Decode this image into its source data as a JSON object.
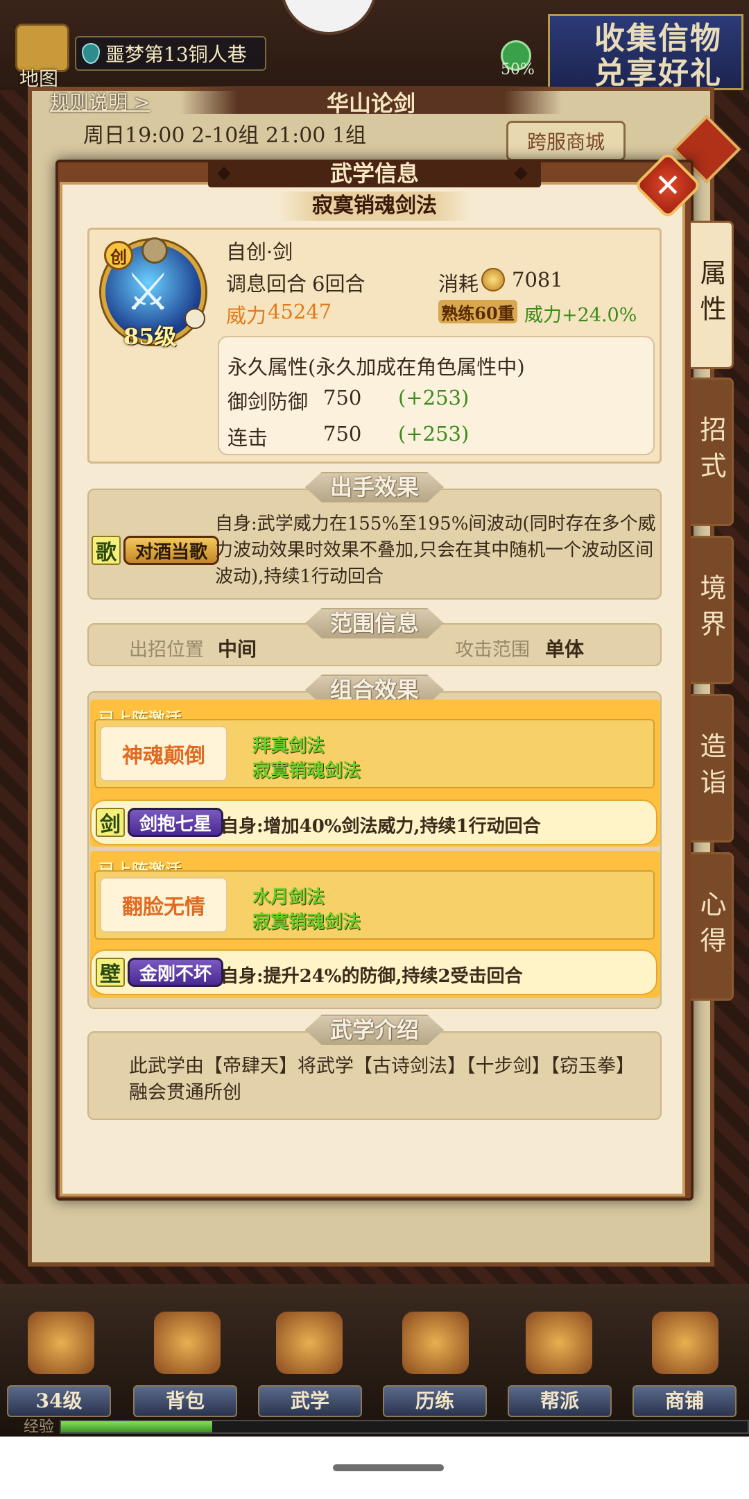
{
  "hud": {
    "map_label": "地图",
    "location": "噩梦第13铜人巷",
    "progress_pct": "50%",
    "promo_line1": "收集信物",
    "promo_line2": "兑享好礼"
  },
  "under_panel": {
    "rules_link": "规则说明 >",
    "title": "华山论剑",
    "schedule": "周日19:00 2-10组 21:00 1组",
    "shop_button": "跨服商城"
  },
  "modal": {
    "title": "武学信息",
    "skill_name": "寂寞销魂剑法",
    "close": "✕"
  },
  "side_tabs": [
    "属性",
    "招式",
    "境界",
    "造诣",
    "心得"
  ],
  "skill": {
    "type": "自创·剑",
    "chuang_badge": "创",
    "level": "85级",
    "cooldown_label": "调息回合",
    "cooldown_value": "6回合",
    "cost_label": "消耗",
    "cost_value": "7081",
    "power_label": "威力",
    "power_value": "45247",
    "mastery_badge": "熟练60重",
    "mastery_bonus": "威力+24.0%",
    "permanent_title": "永久属性(永久加成在角色属性中)",
    "permanent_attrs": [
      {
        "name": "御剑防御",
        "value": "750",
        "bonus": "(+253)"
      },
      {
        "name": "连击",
        "value": "750",
        "bonus": "(+253)"
      }
    ]
  },
  "sections": {
    "effect": "出手效果",
    "range": "范围信息",
    "combo": "组合效果",
    "intro": "武学介绍"
  },
  "effect": {
    "letter": "歌",
    "tag": "对酒当歌",
    "description": "自身:武学威力在155%至195%间波动(同时存在多个威力波动效果时效果不叠加,只会在其中随机一个波动区间波动),持续1行动回合"
  },
  "range": {
    "position_label": "出招位置",
    "position_value": "中间",
    "scope_label": "攻击范围",
    "scope_value": "单体"
  },
  "combos": [
    {
      "active_label": "已上阵激活",
      "name": "神魂颠倒",
      "skills": [
        "拜真剑法",
        "寂寞销魂剑法"
      ],
      "letter": "剑",
      "tag": "剑抱七星",
      "effect": "自身:增加40%剑法威力,持续1行动回合"
    },
    {
      "active_label": "已上阵激活",
      "name": "翻脸无情",
      "skills": [
        "水月剑法",
        "寂寞销魂剑法"
      ],
      "letter": "壁",
      "tag": "金刚不坏",
      "effect": "自身:提升24%的防御,持续2受击回合"
    }
  ],
  "intro": "此武学由【帝肆天】将武学【古诗剑法】【十步剑】【窃玉拳】融会贯通所创",
  "bottom_nav": {
    "items": [
      "34级",
      "背包",
      "武学",
      "历练",
      "帮派",
      "商铺"
    ],
    "exp_label": "经验",
    "exp_progress": 0.22
  },
  "colors": {
    "power_orange": "#e07a1a",
    "bonus_green": "#3a8a1a",
    "combo_gold": "#ffc040"
  }
}
